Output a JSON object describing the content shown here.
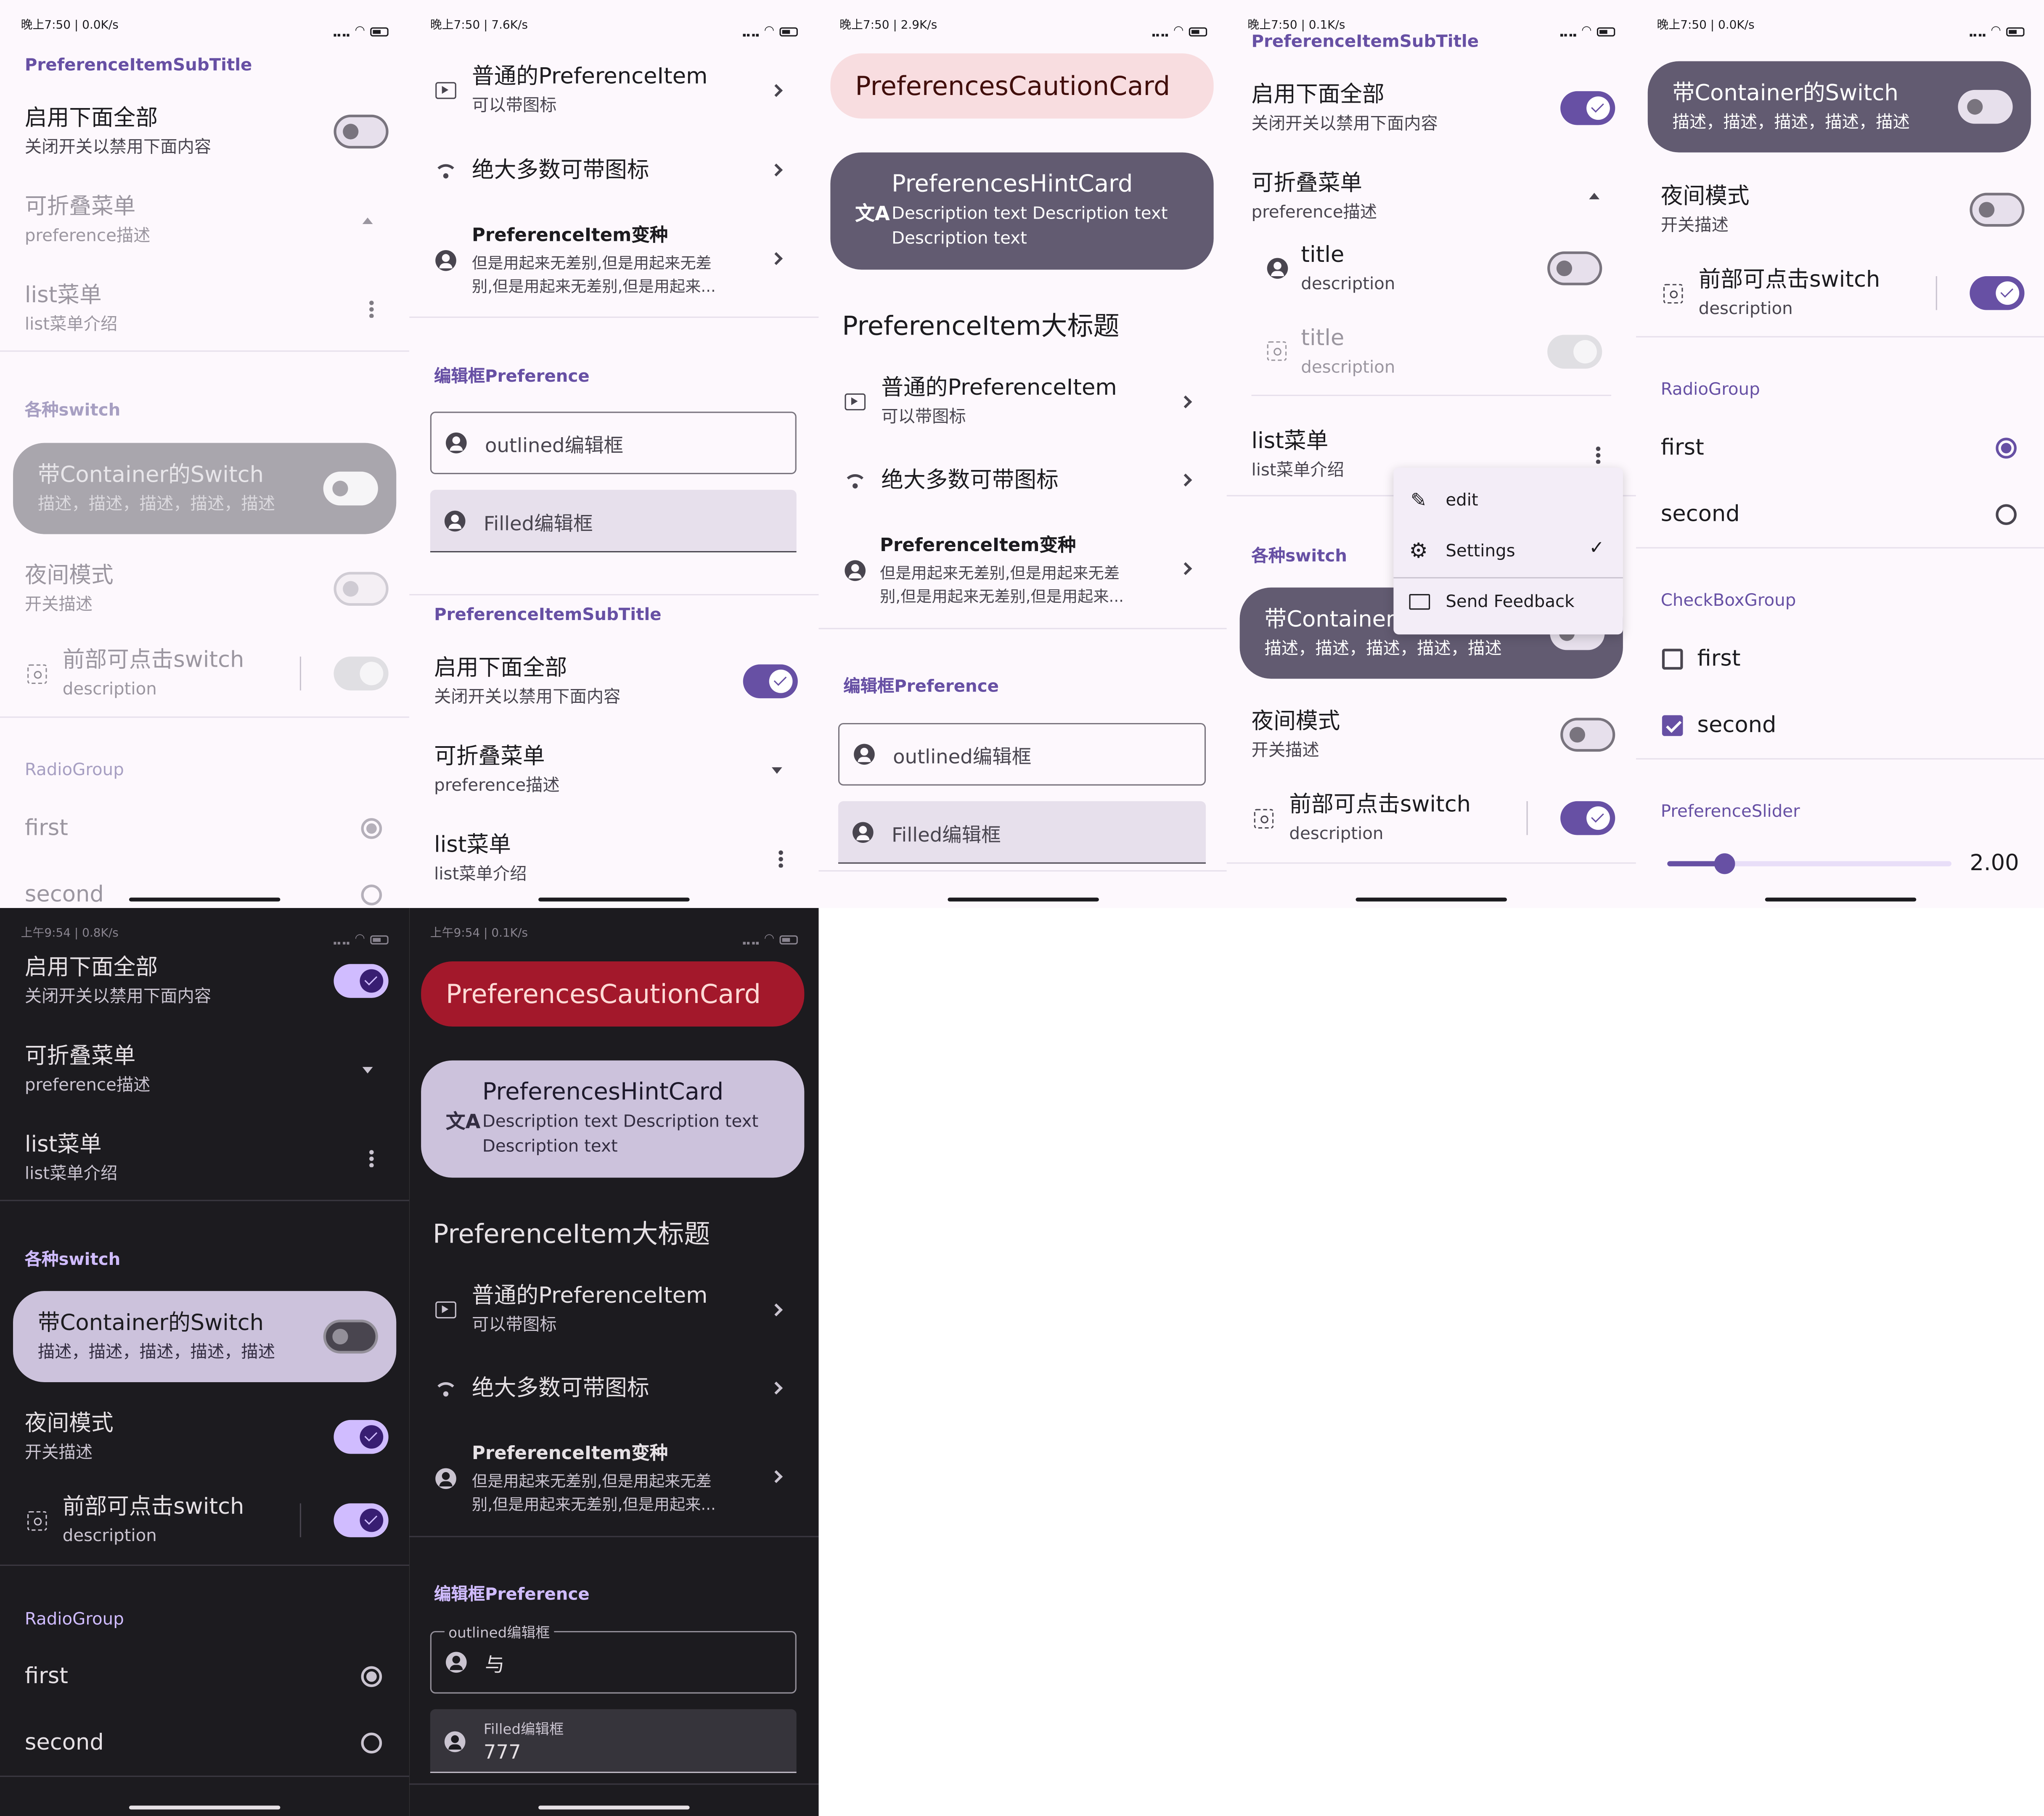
{
  "status": {
    "light": [
      "晚上7:50 | 0.0K/s",
      "晚上7:50 | 7.6K/s",
      "晚上7:50 | 2.9K/s",
      "晚上7:50 | 0.1K/s",
      "晚上7:50 | 0.0K/s"
    ],
    "dark": [
      "上午9:54 | 0.8K/s",
      "上午9:54 | 0.1K/s"
    ]
  },
  "p1": {
    "sec_sub": "PreferenceItemSubTitle",
    "enable_t": "启用下面全部",
    "enable_d": "关闭开关以禁用下面内容",
    "fold_t": "可折叠菜单",
    "fold_d": "preference描述",
    "list_t": "list菜单",
    "list_d": "list菜单介绍",
    "sec_sw": "各种switch",
    "cont_t": "带Container的Switch",
    "cont_d": "描述，描述，描述，描述，描述",
    "night_t": "夜间模式",
    "night_d": "开关描述",
    "front_t": "前部可点击switch",
    "front_d": "description",
    "sec_radio": "RadioGroup",
    "first": "first",
    "second": "second"
  },
  "p2": {
    "normal_t": "普通的PreferenceItem",
    "normal_d": "可以带图标",
    "icon_t": "绝大多数可带图标",
    "var_t": "PreferenceItem变种",
    "var_d1": "但是用起来无差别,但是用起来无差",
    "var_d2": "别,但是用起来无差别,但是用起来...",
    "sec_edit": "编辑框Preference",
    "outlined": "outlined编辑框",
    "filled": "Filled编辑框",
    "sec_sub": "PreferenceItemSubTitle",
    "enable_t": "启用下面全部",
    "enable_d": "关闭开关以禁用下面内容",
    "fold_t": "可折叠菜单",
    "fold_d": "preference描述",
    "list_t": "list菜单",
    "list_d": "list菜单介绍"
  },
  "p3": {
    "caution": "PreferencesCautionCard",
    "hint_t": "PreferencesHintCard",
    "hint_d1": "Description text Description text",
    "hint_d2": "Description text",
    "big": "PreferenceItem大标题",
    "normal_t": "普通的PreferenceItem",
    "normal_d": "可以带图标",
    "icon_t": "绝大多数可带图标",
    "var_t": "PreferenceItem变种",
    "var_d1": "但是用起来无差别,但是用起来无差",
    "var_d2": "别,但是用起来无差别,但是用起来...",
    "sec_edit": "编辑框Preference",
    "outlined": "outlined编辑框",
    "filled": "Filled编辑框"
  },
  "p4": {
    "sec_sub": "PreferenceItemSubTitle",
    "enable_t": "启用下面全部",
    "enable_d": "关闭开关以禁用下面内容",
    "fold_t": "可折叠菜单",
    "fold_d": "preference描述",
    "title": "title",
    "desc": "description",
    "list_t": "list菜单",
    "list_d": "list菜单介绍",
    "sec_sw": "各种switch",
    "cont_t": "带Container的Switch",
    "cont_d": "描述，描述，描述，描述，描述",
    "night_t": "夜间模式",
    "night_d": "开关描述",
    "front_t": "前部可点击switch",
    "front_d": "description",
    "menu": {
      "edit": "edit",
      "settings": "Settings",
      "feedback": "Send Feedback"
    }
  },
  "p5": {
    "cont_t": "带Container的Switch",
    "cont_d": "描述，描述，描述，描述，描述",
    "night_t": "夜间模式",
    "night_d": "开关描述",
    "front_t": "前部可点击switch",
    "front_d": "description",
    "sec_radio": "RadioGroup",
    "first": "first",
    "second": "second",
    "sec_check": "CheckBoxGroup",
    "cfirst": "first",
    "csecond": "second",
    "sec_slider": "PreferenceSlider",
    "slider_val": "2.00",
    "slider_value": 2.0
  },
  "p6": {
    "enable_t": "启用下面全部",
    "enable_d": "关闭开关以禁用下面内容",
    "fold_t": "可折叠菜单",
    "fold_d": "preference描述",
    "list_t": "list菜单",
    "list_d": "list菜单介绍",
    "sec_sw": "各种switch",
    "cont_t": "带Container的Switch",
    "cont_d": "描述，描述，描述，描述，描述",
    "night_t": "夜间模式",
    "night_d": "开关描述",
    "front_t": "前部可点击switch",
    "front_d": "description",
    "sec_radio": "RadioGroup",
    "first": "first",
    "second": "second"
  },
  "p7": {
    "caution": "PreferencesCautionCard",
    "hint_t": "PreferencesHintCard",
    "hint_d1": "Description text Description text",
    "hint_d2": "Description text",
    "big": "PreferenceItem大标题",
    "normal_t": "普通的PreferenceItem",
    "normal_d": "可以带图标",
    "icon_t": "绝大多数可带图标",
    "var_t": "PreferenceItem变种",
    "var_d1": "但是用起来无差别,但是用起来无差",
    "var_d2": "别,但是用起来无差别,但是用起来...",
    "sec_edit": "编辑框Preference",
    "outlined_label": "outlined编辑框",
    "outlined_val": "与",
    "filled_label": "Filled编辑框",
    "filled_val": "777"
  },
  "colors": {
    "primary": "#6750a4",
    "primary_dark": "#d0bcff",
    "caution_light": "#f8dde0",
    "caution_dark": "#a3182b",
    "hint_light": "#625b71",
    "hint_dark": "#ccc2dc"
  }
}
